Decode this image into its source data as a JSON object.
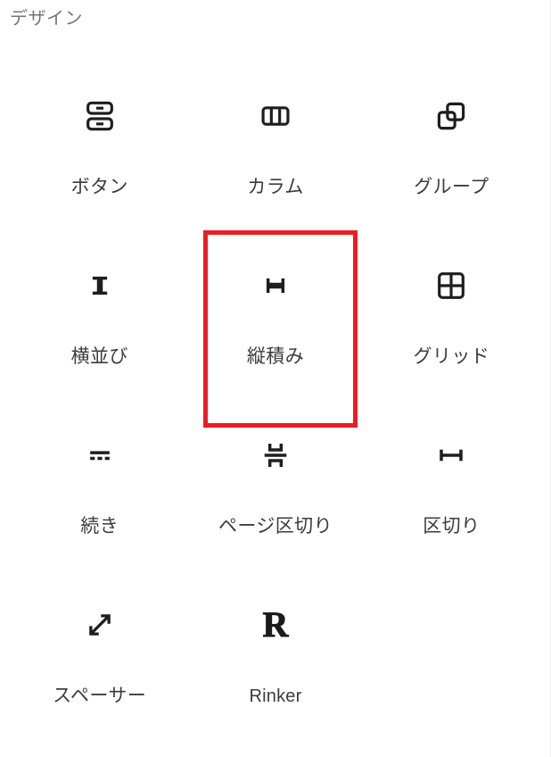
{
  "panel": {
    "category_title": "デザイン",
    "accent_color": "#ec1c24",
    "text_color": "#3c3c3c",
    "heading_color": "#757575",
    "icon_color": "#1e1e1e",
    "background": "#ffffff"
  },
  "blocks": [
    {
      "id": "buttons",
      "label": "ボタン",
      "icon": "buttons-icon",
      "script": "jp"
    },
    {
      "id": "columns",
      "label": "カラム",
      "icon": "columns-icon",
      "script": "jp"
    },
    {
      "id": "group",
      "label": "グループ",
      "icon": "group-icon",
      "script": "jp"
    },
    {
      "id": "row",
      "label": "横並び",
      "icon": "row-icon",
      "script": "jp"
    },
    {
      "id": "stack",
      "label": "縦積み",
      "icon": "stack-icon",
      "script": "jp"
    },
    {
      "id": "grid",
      "label": "グリッド",
      "icon": "grid-icon",
      "script": "jp"
    },
    {
      "id": "more",
      "label": "続き",
      "icon": "more-icon",
      "script": "jp"
    },
    {
      "id": "page-break",
      "label": "ページ区切り",
      "icon": "page-break-icon",
      "script": "jp"
    },
    {
      "id": "separator",
      "label": "区切り",
      "icon": "separator-icon",
      "script": "jp"
    },
    {
      "id": "spacer",
      "label": "スペーサー",
      "icon": "spacer-icon",
      "script": "jp"
    },
    {
      "id": "rinker",
      "label": "Rinker",
      "icon": "rinker-icon",
      "script": "latin",
      "mark": "R"
    }
  ],
  "annotation": {
    "target_block_id": "stack",
    "color": "#ec1c24",
    "border_width": 5
  }
}
